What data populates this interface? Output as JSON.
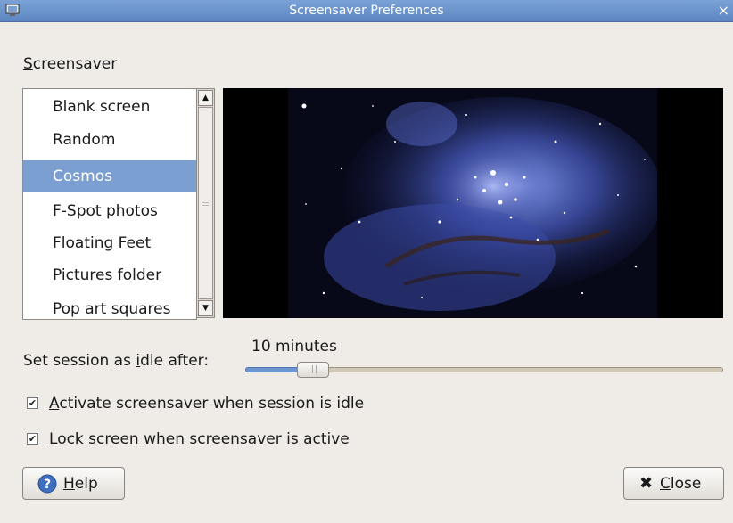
{
  "window": {
    "title": "Screensaver Preferences",
    "close_glyph": "×"
  },
  "screensaver": {
    "label_mnemonic": "S",
    "label_rest": "creensaver",
    "items": [
      {
        "label": "Blank screen",
        "selected": false
      },
      {
        "label": "Random",
        "selected": false
      },
      {
        "label": "Cosmos",
        "selected": true
      },
      {
        "label": "F-Spot photos",
        "selected": false
      },
      {
        "label": "Floating Feet",
        "selected": false
      },
      {
        "label": "Pictures folder",
        "selected": false
      },
      {
        "label": "Pop art squares",
        "selected": false
      }
    ]
  },
  "idle": {
    "label_before": "Set session as ",
    "label_mnemonic": "i",
    "label_after": "dle after:",
    "value": "10 minutes",
    "slider_fraction": 0.1
  },
  "checks": {
    "activate": {
      "checked": true,
      "mnemonic": "A",
      "rest": "ctivate screensaver when session is idle"
    },
    "lock": {
      "checked": true,
      "mnemonic": "L",
      "rest": "ock screen when screensaver is active"
    }
  },
  "buttons": {
    "help": {
      "mnemonic": "H",
      "rest": "elp"
    },
    "close": {
      "mnemonic": "C",
      "rest": "lose"
    }
  },
  "colors": {
    "titlebar": "#6a92cb",
    "selection": "#7a9fd0",
    "slider_fill": "#6d96d0"
  },
  "icons": [
    "window-menu-icon",
    "close-icon",
    "scroll-up-arrow-icon",
    "scroll-down-arrow-icon",
    "checkmark-icon",
    "help-icon",
    "close-x-icon"
  ]
}
